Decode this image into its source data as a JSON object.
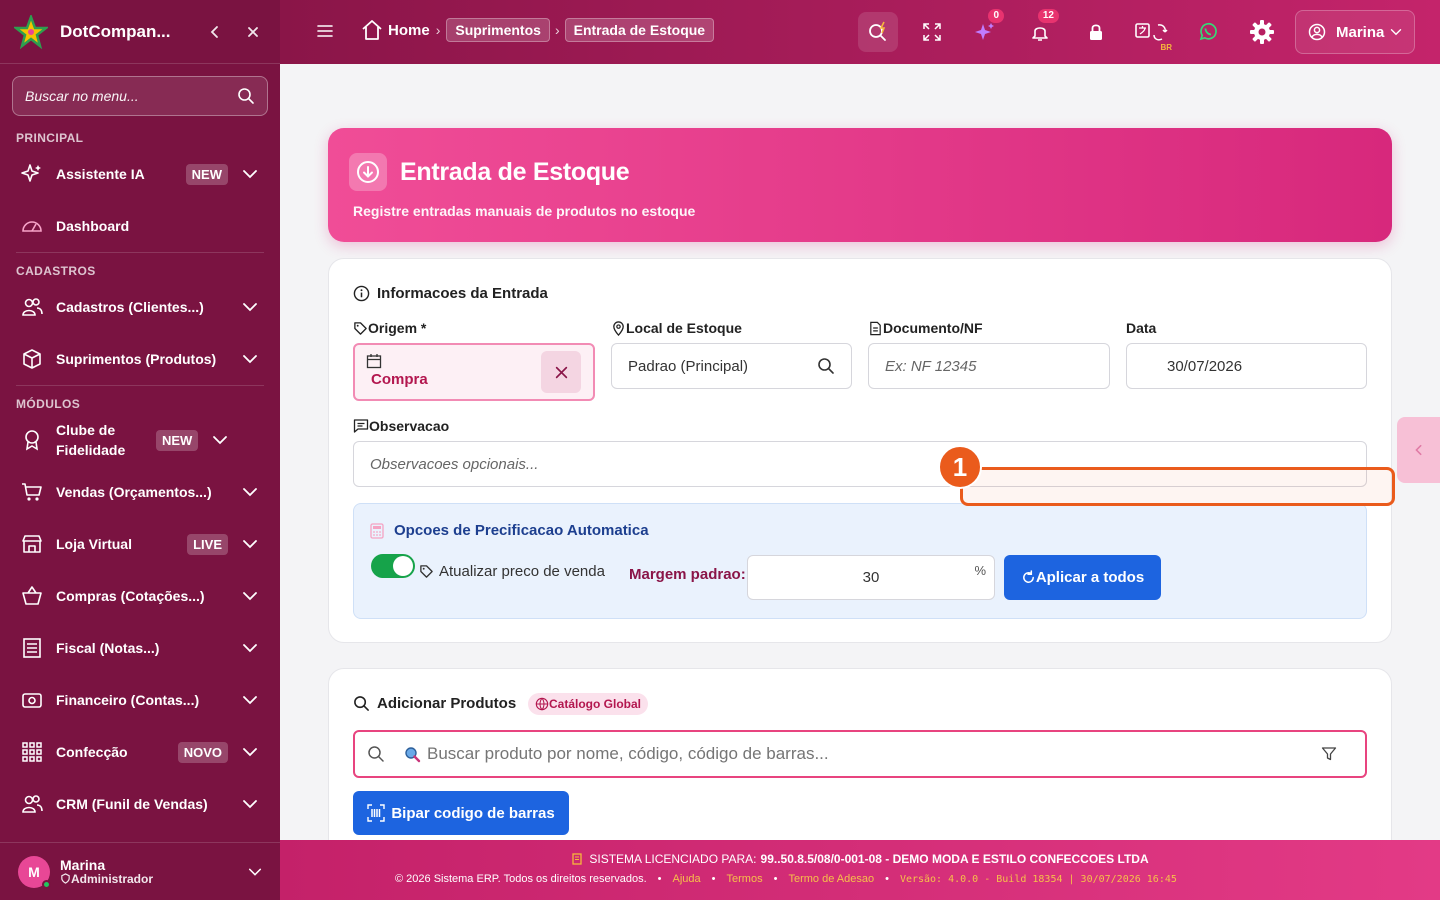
{
  "sidebar": {
    "brand": "DotCompan...",
    "search_placeholder": "Buscar no menu...",
    "sections": {
      "principal": "PRINCIPAL",
      "cadastros": "CADASTROS",
      "modulos": "MÓDULOS"
    },
    "items": [
      {
        "label": "Assistente IA",
        "badge": "NEW",
        "icon": "sparkle-icon"
      },
      {
        "label": "Dashboard",
        "icon": "gauge-icon"
      },
      {
        "label": "Cadastros (Clientes...)",
        "icon": "users-icon"
      },
      {
        "label": "Suprimentos (Produtos)",
        "icon": "box-icon"
      },
      {
        "label": "Clube de Fidelidade",
        "badge": "NEW",
        "icon": "award-icon"
      },
      {
        "label": "Vendas (Orçamentos...)",
        "icon": "cart-icon"
      },
      {
        "label": "Loja Virtual",
        "badge": "LIVE",
        "icon": "store-icon"
      },
      {
        "label": "Compras (Cotações...)",
        "icon": "basket-icon"
      },
      {
        "label": "Fiscal (Notas...)",
        "icon": "receipt-icon"
      },
      {
        "label": "Financeiro (Contas...)",
        "icon": "cash-icon"
      },
      {
        "label": "Confecção",
        "badge": "NOVO",
        "icon": "grid-icon"
      },
      {
        "label": "CRM (Funil de Vendas)",
        "icon": "users-icon"
      }
    ],
    "user": {
      "name": "Marina",
      "role": "Administrador",
      "initial": "M"
    }
  },
  "topbar": {
    "breadcrumb": {
      "home": "Home",
      "section": "Suprimentos",
      "page": "Entrada de Estoque"
    },
    "badges": {
      "ai": "0",
      "notifications": "12"
    },
    "lang_code": "BR",
    "user_name": "Marina"
  },
  "hero": {
    "title": "Entrada de Estoque",
    "subtitle": "Registre entradas manuais de produtos no estoque"
  },
  "info": {
    "title": "Informacoes da Entrada",
    "origem": {
      "label": "Origem *",
      "value": "Compra"
    },
    "local": {
      "label": "Local de Estoque",
      "value": "Padrao (Principal)"
    },
    "documento": {
      "label": "Documento/NF",
      "placeholder": "Ex: NF 12345"
    },
    "data": {
      "label": "Data",
      "value": "30/07/2026"
    },
    "observacao": {
      "label": "Observacao",
      "placeholder": "Observacoes opcionais..."
    }
  },
  "pricing": {
    "title": "Opcoes de Precificacao Automatica",
    "toggle_label": "Atualizar preco de venda",
    "toggle_on": true,
    "margin_label": "Margem padrao:",
    "margin_value": "30",
    "margin_unit": "%",
    "apply_button": "Aplicar a todos"
  },
  "products": {
    "title": "Adicionar Produtos",
    "catalog_badge": "Catálogo Global",
    "search_placeholder": "Buscar produto por nome, código, código de barras...",
    "barcode_button": "Bipar codigo de barras"
  },
  "footer": {
    "license_prefix": "SISTEMA LICENCIADO PARA:",
    "license_value": "99..50.8.5/08/0-001-08 - DEMO MODA E ESTILO CONFECCOES LTDA",
    "copyright": "© 2026 Sistema ERP. Todos os direitos reservados.",
    "links": [
      "Ajuda",
      "Termos",
      "Termo de Adesao"
    ],
    "version": "Versão: 4.0.0 - Build 18354 | 30/07/2026 16:45"
  },
  "annotation": {
    "number": "1"
  },
  "colors": {
    "sidebar_bg": "#7a1341",
    "accent": "#d7287c",
    "primary_button": "#1d64e0",
    "annotation": "#ea5b1c"
  }
}
